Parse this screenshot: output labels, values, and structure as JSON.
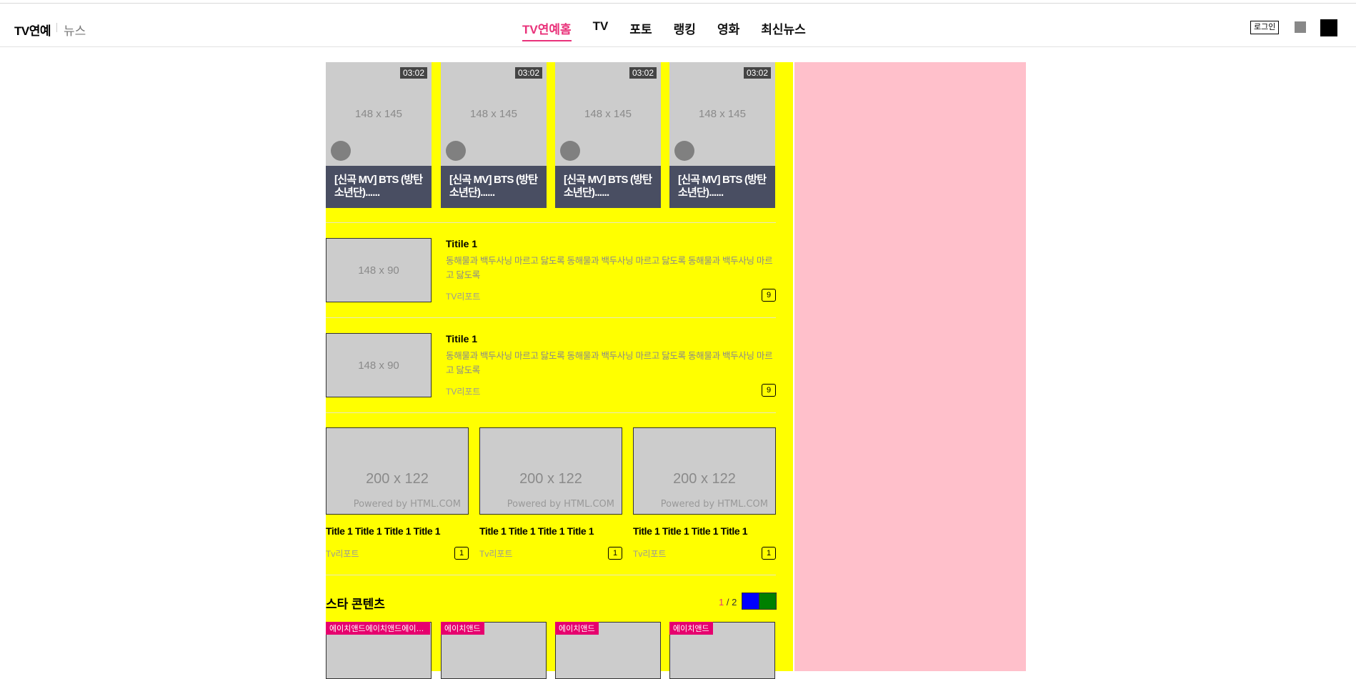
{
  "header": {
    "brand": "TV연예",
    "brand_sub": "뉴스",
    "nav": [
      "TV연예홈",
      "TV",
      "포토",
      "랭킹",
      "영화",
      "최신뉴스"
    ],
    "login": "로그인"
  },
  "videos": [
    {
      "time": "03:02",
      "thumb": "148 x 145",
      "caption": "[신곡 MV] BTS (방탄소년단)......"
    },
    {
      "time": "03:02",
      "thumb": "148 x 145",
      "caption": "[신곡 MV] BTS (방탄소년단)......"
    },
    {
      "time": "03:02",
      "thumb": "148 x 145",
      "caption": "[신곡 MV] BTS (방탄소년단)......"
    },
    {
      "time": "03:02",
      "thumb": "148 x 145",
      "caption": "[신곡 MV] BTS (방탄소년단)......"
    }
  ],
  "list": [
    {
      "thumb": "148 x 90",
      "title": "Titile 1",
      "desc": "동해물과 백두사닝 마르고 닳도록 동해물과 백두사닝 마르고 닳도록 동해물과 백두사닝 마르고 닳도록",
      "source": "TV리포트",
      "count": "9"
    },
    {
      "thumb": "148 x 90",
      "title": "Titile 1",
      "desc": "동해물과 백두사닝 마르고 닳도록 동해물과 백두사닝 마르고 닳도록 동해물과 백두사닝 마르고 닳도록",
      "source": "TV리포트",
      "count": "9"
    }
  ],
  "grid": [
    {
      "thumb": "200 x 122",
      "powered": "Powered by HTML.COM",
      "title": "Title 1 Title 1 Title 1 Title 1",
      "source": "Tv리포트",
      "count": "1"
    },
    {
      "thumb": "200 x 122",
      "powered": "Powered by HTML.COM",
      "title": "Title 1 Title 1 Title 1 Title 1",
      "source": "Tv리포트",
      "count": "1"
    },
    {
      "thumb": "200 x 122",
      "powered": "Powered by HTML.COM",
      "title": "Title 1 Title 1 Title 1 Title 1",
      "source": "Tv리포트",
      "count": "1"
    }
  ],
  "star": {
    "title": "스타 콘텐츠",
    "page_current": "1",
    "page_total": " / 2",
    "cards": [
      "에이치앤드에이치앤드에이치앤드",
      "에이치앤드",
      "에이치앤드",
      "에이치앤드"
    ]
  }
}
